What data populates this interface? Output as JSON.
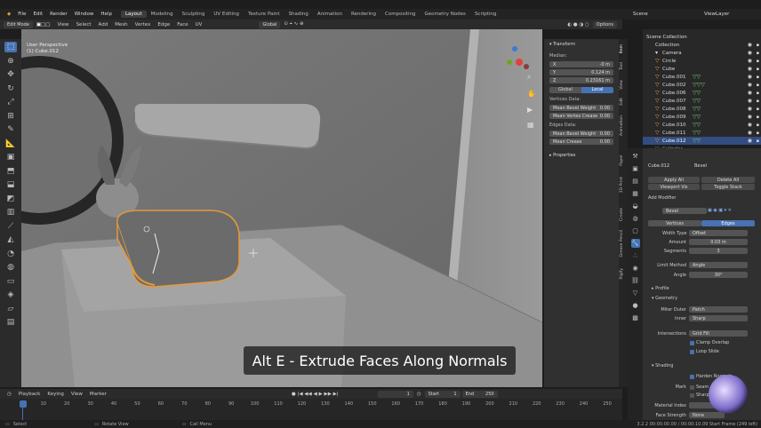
{
  "menu": {
    "items": [
      "File",
      "Edit",
      "Render",
      "Window",
      "Help"
    ],
    "workspaces": [
      "Layout",
      "Modeling",
      "Sculpting",
      "UV Editing",
      "Texture Paint",
      "Shading",
      "Animation",
      "Rendering",
      "Compositing",
      "Geometry Nodes",
      "Scripting"
    ],
    "active_workspace": "Layout",
    "scene_label": "Scene",
    "viewlayer_label": "ViewLayer"
  },
  "header": {
    "mode": "Edit Mode",
    "menus": [
      "View",
      "Select",
      "Add",
      "Mesh",
      "Vertex",
      "Edge",
      "Face",
      "UV"
    ],
    "orientation": "Global",
    "options": "Options"
  },
  "viewport": {
    "perspective": "User Perspective",
    "object": "(1) Cube.012",
    "caption": "Alt E - Extrude Faces Along Normals"
  },
  "npanel": {
    "transform": "Transform",
    "median": "Median:",
    "x": "X",
    "x_val": "-0 m",
    "y": "Y",
    "y_val": "0.124 m",
    "z": "Z",
    "z_val": "0.23161 m",
    "global": "Global",
    "local": "Local",
    "vertices_data": "Vertices Data:",
    "mean_bevel_weight": "Mean Bevel Weight",
    "mean_bevel_weight_val": "0.00",
    "mean_vertex_crease": "Mean Vertex Crease",
    "mean_vertex_crease_val": "0.00",
    "edges_data": "Edges Data:",
    "mean_bevel_weight2": "Mean Bevel Weight",
    "mean_bevel_weight2_val": "0.00",
    "mean_crease": "Mean Crease",
    "mean_crease_val": "0.00",
    "properties": "Properties",
    "tabs": [
      "Item",
      "Tool",
      "View",
      "Edit",
      "Animation",
      "Paper",
      "3D-Print",
      "Create",
      "Grease Pencil",
      "Rigify"
    ]
  },
  "outliner": {
    "collection_root": "Scene Collection",
    "collection": "Collection",
    "items": [
      "Camera",
      "Circle",
      "Cube",
      "Cube.001",
      "Cube.002",
      "Cube.006",
      "Cube.007",
      "Cube.008",
      "Cube.009",
      "Cube.010",
      "Cube.011",
      "Cube.012",
      "Cylinder"
    ],
    "selected": "Cube.012"
  },
  "properties": {
    "object_name": "Cube.012",
    "modifier_type": "Bevel",
    "apply_all": "Apply All",
    "delete_all": "Delete All",
    "viewport_vis": "Viewport Vis",
    "toggle_stack": "Toggle Stack",
    "add_modifier": "Add Modifier",
    "modifier_name": "Bevel",
    "vertices": "Vertices",
    "edges": "Edges",
    "width_type_label": "Width Type",
    "width_type": "Offset",
    "amount_label": "Amount",
    "amount": "0.03 m",
    "segments_label": "Segments",
    "segments": "3",
    "limit_method_label": "Limit Method",
    "limit_method": "Angle",
    "angle_label": "Angle",
    "angle": "30°",
    "profile": "Profile",
    "geometry": "Geometry",
    "miter_outer_label": "Miter Outer",
    "miter_outer": "Patch",
    "inner_label": "Inner",
    "inner": "Sharp",
    "intersections_label": "Intersections",
    "intersections": "Grid Fill",
    "clamp_overlap": "Clamp Overlap",
    "loop_slide": "Loop Slide",
    "shading": "Shading",
    "harden_normals": "Harden Normals",
    "mark_label": "Mark",
    "seam": "Seam",
    "sharp": "Sharp",
    "material_index_label": "Material Index",
    "face_strength_label": "Face Strength",
    "face_strength": "None"
  },
  "timeline": {
    "menus": [
      "Playback",
      "Keying",
      "View",
      "Marker"
    ],
    "current_frame": "1",
    "start_label": "Start",
    "start": "1",
    "end_label": "End",
    "end": "250",
    "ticks": [
      "1",
      "10",
      "20",
      "30",
      "40",
      "50",
      "60",
      "70",
      "80",
      "90",
      "100",
      "110",
      "120",
      "130",
      "140",
      "150",
      "160",
      "170",
      "180",
      "190",
      "200",
      "210",
      "220",
      "230",
      "240",
      "250"
    ]
  },
  "status": {
    "select": "Select",
    "rotate_view": "Rotate View",
    "call_menu": "Call Menu",
    "right": "3.2.2  00:00:00.00 / 00:00:10.09  Start Frame (249 left)"
  },
  "colors": {
    "accent": "#4772b3",
    "selection": "#e59a3a",
    "viewport_bg": "#6f6f6f"
  }
}
